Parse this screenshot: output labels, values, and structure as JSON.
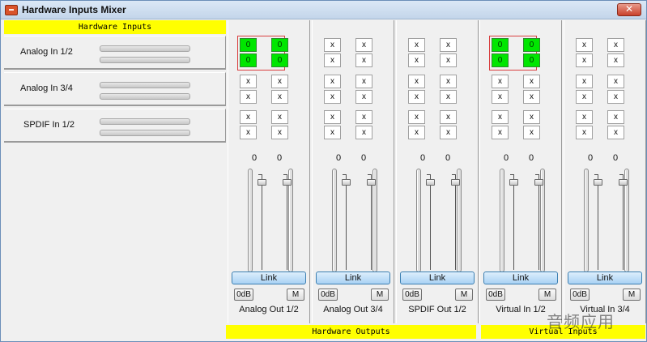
{
  "window": {
    "title": "Hardware Inputs Mixer",
    "close_label": "✕",
    "icon": "app-icon"
  },
  "left_panel": {
    "header": "Hardware Inputs",
    "inputs": [
      {
        "label": "Analog In  1/2"
      },
      {
        "label": "Analog In  3/4"
      },
      {
        "label": "SPDIF In 1/2"
      }
    ]
  },
  "strips": [
    {
      "label": "Analog Out 1/2",
      "cells": [
        "0",
        "0",
        "0",
        "0",
        "x",
        "x",
        "x",
        "x",
        "x",
        "x",
        "x",
        "x"
      ],
      "highlight_first": true,
      "levels": [
        "0",
        "0"
      ],
      "link": "Link",
      "zero_db": "0dB",
      "mute": "M"
    },
    {
      "label": "Analog Out 3/4",
      "cells": [
        "x",
        "x",
        "x",
        "x",
        "x",
        "x",
        "x",
        "x",
        "x",
        "x",
        "x",
        "x"
      ],
      "highlight_first": false,
      "levels": [
        "0",
        "0"
      ],
      "link": "Link",
      "zero_db": "0dB",
      "mute": "M"
    },
    {
      "label": "SPDIF Out 1/2",
      "cells": [
        "x",
        "x",
        "x",
        "x",
        "x",
        "x",
        "x",
        "x",
        "x",
        "x",
        "x",
        "x"
      ],
      "highlight_first": false,
      "levels": [
        "0",
        "0"
      ],
      "link": "Link",
      "zero_db": "0dB",
      "mute": "M"
    },
    {
      "label": "Virtual In 1/2",
      "cells": [
        "0",
        "0",
        "0",
        "0",
        "x",
        "x",
        "x",
        "x",
        "x",
        "x",
        "x",
        "x"
      ],
      "highlight_first": true,
      "levels": [
        "0",
        "0"
      ],
      "link": "Link",
      "zero_db": "0dB",
      "mute": "M"
    },
    {
      "label": "Virtual In 3/4",
      "cells": [
        "x",
        "x",
        "x",
        "x",
        "x",
        "x",
        "x",
        "x",
        "x",
        "x",
        "x",
        "x"
      ],
      "highlight_first": false,
      "levels": [
        "0",
        "0"
      ],
      "link": "Link",
      "zero_db": "0dB",
      "mute": "M"
    }
  ],
  "group_headers": {
    "outputs": "Hardware Outputs",
    "virtual": "Virtual Inputs"
  },
  "watermark": "音频应用",
  "colors": {
    "header_yellow": "#ffff00",
    "active_cell": "#00e600",
    "highlight_border": "#d84040",
    "link_button": "#a9d2f4"
  }
}
